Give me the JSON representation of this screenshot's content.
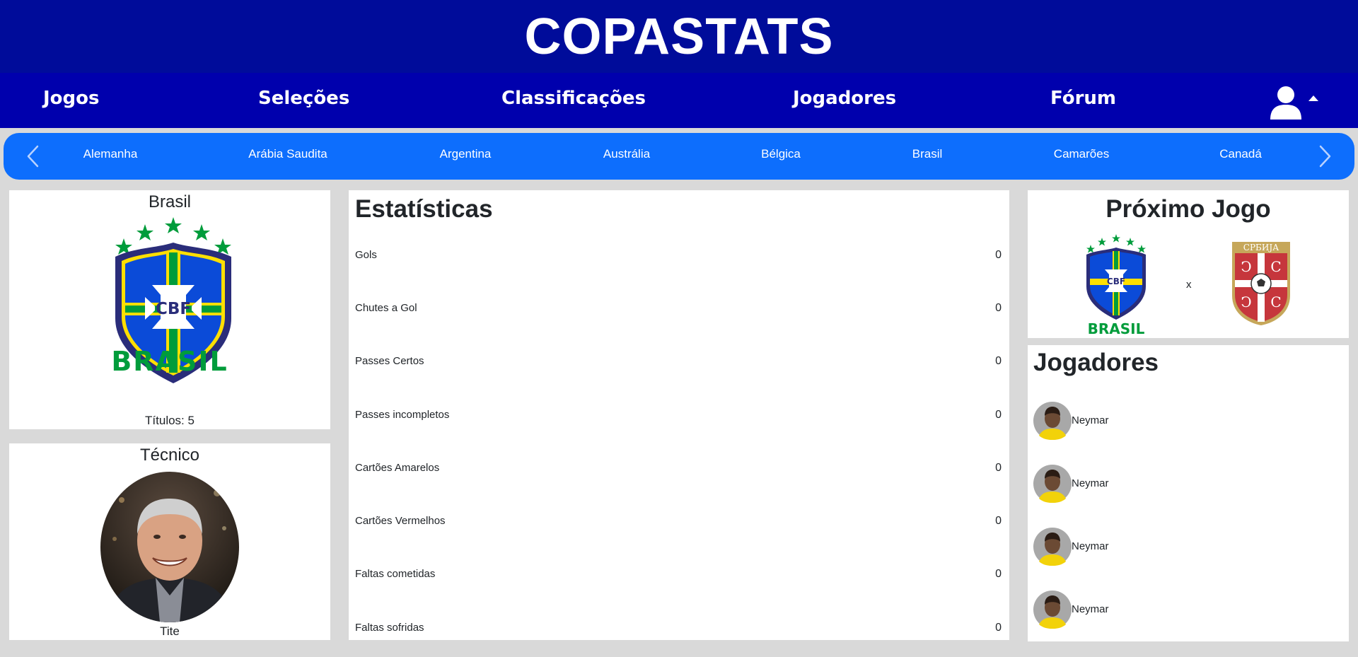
{
  "header": {
    "title": "COPASTATS"
  },
  "nav": {
    "items": [
      "Jogos",
      "Seleções",
      "Classificações",
      "Jogadores",
      "Fórum"
    ],
    "user_icon": "user-icon",
    "dropdown_icon": "caret-up-icon"
  },
  "teams_carousel": {
    "teams": [
      "Alemanha",
      "Arábia Saudita",
      "Argentina",
      "Austrália",
      "Bélgica",
      "Brasil",
      "Camarões",
      "Canadá"
    ],
    "prev_icon": "chevron-left-icon",
    "next_icon": "chevron-right-icon"
  },
  "team_card": {
    "name": "Brasil",
    "crest_text": "CBF",
    "crest_wordmark": "BRASIL",
    "titles": "Títulos: 5"
  },
  "coach_card": {
    "title": "Técnico",
    "name": "Tite"
  },
  "stats": {
    "title": "Estatísticas",
    "rows": [
      {
        "label": "Gols",
        "value": "0"
      },
      {
        "label": "Chutes a Gol",
        "value": "0"
      },
      {
        "label": "Passes Certos",
        "value": "0"
      },
      {
        "label": "Passes incompletos",
        "value": "0"
      },
      {
        "label": "Cartões Amarelos",
        "value": "0"
      },
      {
        "label": "Cartões Vermelhos",
        "value": "0"
      },
      {
        "label": "Faltas cometidas",
        "value": "0"
      },
      {
        "label": "Faltas sofridas",
        "value": "0"
      }
    ]
  },
  "next_match": {
    "title": "Próximo Jogo",
    "home_crest_text": "CBF",
    "home_wordmark": "BRASIL",
    "separator": "x",
    "away_crest_text": "СРБИЈА"
  },
  "players": {
    "title": "Jogadores",
    "list": [
      "Neymar",
      "Neymar",
      "Neymar",
      "Neymar"
    ]
  },
  "colors": {
    "top_header": "#000c9a",
    "navbar": "#0000ad",
    "carousel": "#0d6efd",
    "page_bg": "#d9d9d9",
    "brazil_green": "#009c3b",
    "brazil_yellow": "#fedf00",
    "brazil_blue": "#0b4bd8",
    "serbia_red": "#c6363c"
  }
}
